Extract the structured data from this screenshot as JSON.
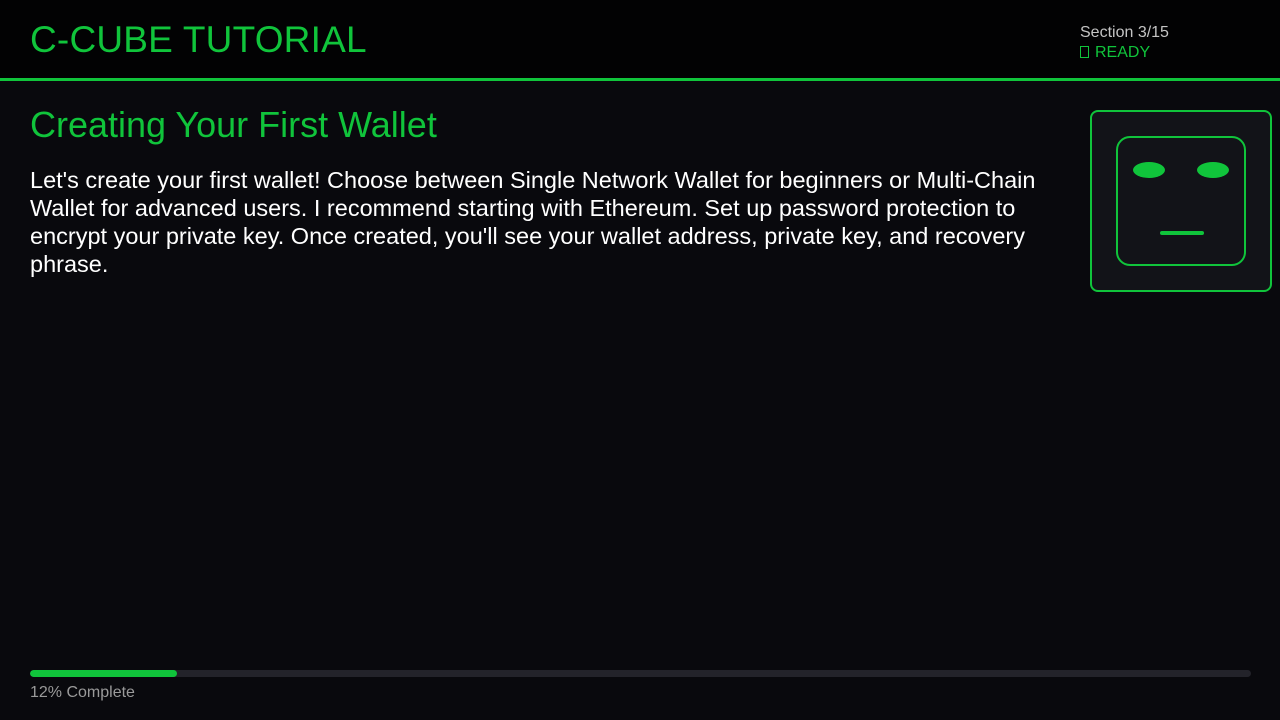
{
  "header": {
    "app_title": "C-CUBE TUTORIAL",
    "section_counter": "Section 3/15",
    "status": "READY"
  },
  "content": {
    "section_title": "Creating Your First Wallet",
    "body": "Let's create your first wallet! Choose between Single Network Wallet for beginners or Multi-Chain Wallet for advanced users. I recommend starting with Ethereum. Set up password protection to encrypt your private key. Once created, you'll see your wallet address, private key, and recovery phrase."
  },
  "avatar": {
    "icon": "robot-face-icon",
    "expression": "neutral"
  },
  "progress": {
    "percent": 12,
    "label": "12% Complete"
  },
  "colors": {
    "accent": "#10c43b",
    "background": "#09090d",
    "header_background": "#020203",
    "text": "#ffffff",
    "muted_text": "#9a9a9a",
    "track": "#23232a"
  }
}
